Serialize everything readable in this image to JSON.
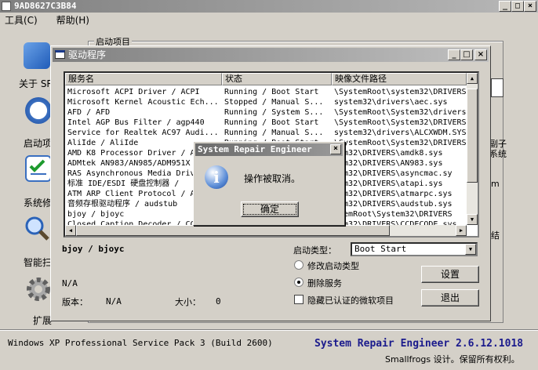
{
  "window": {
    "title": "9AD8627C3B84"
  },
  "menu": {
    "tools": "工具(C)",
    "help": "帮助(H)"
  },
  "sidebar": {
    "items": [
      {
        "label": "关于 SR",
        "icon": "about-icon"
      },
      {
        "label": "启动项",
        "icon": "clock-icon"
      },
      {
        "label": "系统修",
        "icon": "checklist-icon"
      },
      {
        "label": "智能扫",
        "icon": "magnifier-icon"
      },
      {
        "label": "扩展",
        "icon": "gear-icon"
      }
    ]
  },
  "background": {
    "group_label": "启动项目",
    "right_text_1": "副子",
    "right_text_2": "系统",
    "right_text_3": "m",
    "right_text_4": "结"
  },
  "driver_window": {
    "title": "驱动程序",
    "columns": [
      "服务名",
      "状态",
      "映像文件路径"
    ],
    "rows": [
      [
        "Microsoft ACPI Driver / ACPI",
        "Running / Boot Start",
        "\\SystemRoot\\system32\\DRIVERS"
      ],
      [
        "Microsoft Kernel Acoustic Ech...",
        "Stopped / Manual S...",
        "system32\\drivers\\aec.sys"
      ],
      [
        "AFD / AFD",
        "Running / System S...",
        "\\SystemRoot\\System32\\drivers"
      ],
      [
        "Intel AGP Bus Filter / agp440",
        "Running / Boot Start",
        "\\SystemRoot\\System32\\DRIVERS"
      ],
      [
        "Service for Realtek AC97 Audi...",
        "Running / Manual S...",
        "system32\\drivers\\ALCXWDM.SYS"
      ],
      [
        "AliIde / AliIde",
        "Running / Boot Start",
        "\\SystemRoot\\System32\\DRIVERS"
      ],
      [
        "AMD K8 Processor Driver / Amdk8",
        "",
        "tem32\\DRIVERS\\amdk8.sys"
      ],
      [
        "ADMtek AN983/AN985/ADM951X",
        "",
        "tem32\\DRIVERS\\AN983.sys"
      ],
      [
        "RAS Asynchronous Media Driv",
        "",
        "tem32\\DRIVERS\\asyncmac.sy"
      ],
      [
        "标准 IDE/ESDI 硬盘控制器 /",
        "",
        "tem32\\DRIVERS\\atapi.sys"
      ],
      [
        "ATM ARP Client Protocol / A",
        "",
        "tem32\\DRIVERS\\atmarpc.sys"
      ],
      [
        "音频存根驱动程序 / audstub",
        "",
        "tem32\\DRIVERS\\audstub.sys"
      ],
      [
        "bjoy / bjoyc",
        "",
        "stemRoot\\System32\\DRIVERS"
      ],
      [
        "Closed Caption Decoder / CC",
        "",
        "tem32\\DRIVERS\\CCDECODE.sys"
      ]
    ],
    "selected_name": "bjoy / bjoyc",
    "description": "N/A",
    "version_label": "版本：",
    "version_value": "N/A",
    "size_label": "大小：",
    "size_value": "0",
    "start_type_label": "启动类型：",
    "start_type_value": "Boot Start",
    "radio_modify": "修改启动类型",
    "radio_delete": "删除服务",
    "checkbox_hide_ms": "隐藏已认证的微软项目",
    "btn_setup": "设置",
    "btn_exit": "退出"
  },
  "message_box": {
    "title": "System Repair Engineer",
    "text": "操作被取消。",
    "ok": "确定"
  },
  "footer": {
    "os_info": "Windows XP Professional Service Pack 3 (Build 2600)",
    "version": "System Repair Engineer 2.6.12.1018",
    "copyright": "Smallfrogs 设计。保留所有权利。"
  },
  "colors": {
    "accent": "#1a1a8c",
    "titlebar": "#808080",
    "face": "#d4d0c8"
  }
}
